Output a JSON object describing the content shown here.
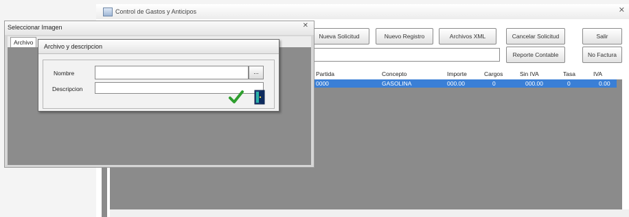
{
  "main_window": {
    "title": "Control de Gastos y Anticipos",
    "close_glyph": "✕",
    "buttons": {
      "nueva_solicitud": "Nueva Solicitud",
      "nuevo_registro": "Nuevo Registro",
      "archivos_xml": "Archivos XML",
      "cancelar_solicitud": "Cancelar Solicitud",
      "salir": "Salir",
      "reporte_contable": "Reporte Contable",
      "no_factura": "No Factura"
    },
    "grid": {
      "columns": [
        "Partida",
        "Concepto",
        "Importe",
        "Cargos",
        "Sin IVA",
        "Tasa",
        "IVA"
      ],
      "rows": [
        [
          "0000",
          "GASOLINA",
          "000.00",
          "0",
          "000.00",
          "0",
          "0.00"
        ]
      ]
    }
  },
  "select_window": {
    "title": "Seleccionar Imagen",
    "close_glyph": "✕",
    "tab_label": "Archivo"
  },
  "dialog": {
    "title": "Archivo y descripcion",
    "nombre_label": "Nombre",
    "descripcion_label": "Descripcion",
    "nombre_value": "",
    "descripcion_value": "",
    "browse_label": "...",
    "accent": "#2e9e2e"
  }
}
